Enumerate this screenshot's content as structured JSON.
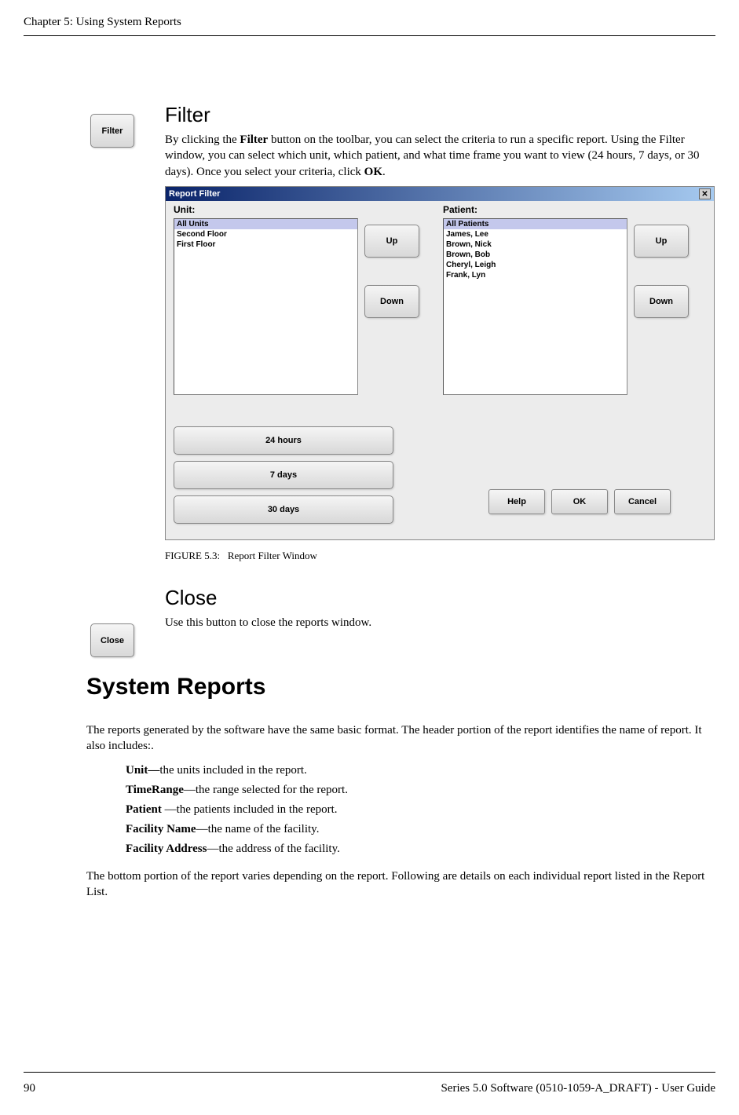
{
  "header": {
    "chapter_title": "Chapter 5: Using System Reports"
  },
  "filter_section": {
    "icon_label": "Filter",
    "heading": "Filter",
    "paragraph_part1": "By clicking the ",
    "paragraph_bold1": "Filter",
    "paragraph_part2": " button on the toolbar, you can select the criteria to run a specific report. Using the Filter window, you can select which unit, which patient, and what time frame you want to view (24 hours, 7 days, or 30 days). Once you select your criteria, click ",
    "paragraph_bold2": "OK",
    "paragraph_part3": "."
  },
  "dialog": {
    "title": "Report Filter",
    "close_x": "✕",
    "unit_label": "Unit:",
    "patient_label": "Patient:",
    "units": [
      "All Units",
      "Second Floor",
      "First Floor"
    ],
    "patients": [
      "All Patients",
      "James, Lee",
      "Brown, Nick",
      "Brown, Bob",
      "Cheryl, Leigh",
      "Frank, Lyn"
    ],
    "up_label": "Up",
    "down_label": "Down",
    "time_24": "24 hours",
    "time_7": "7 days",
    "time_30": "30 days",
    "help_label": "Help",
    "ok_label": "OK",
    "cancel_label": "Cancel"
  },
  "figure_caption": {
    "label": "FIGURE 5.3:",
    "text": "Report Filter Window"
  },
  "close_section": {
    "icon_label": "Close",
    "heading": "Close",
    "paragraph": "Use this button to close the reports window."
  },
  "system_reports": {
    "heading": "System Reports",
    "intro": "The reports generated by the software have the same basic format. The header portion of the report identifies the name of report. It also includes:.",
    "fields": [
      {
        "label": "Unit—",
        "desc": "the units included in the report."
      },
      {
        "label": "TimeRange",
        "desc": "—the range selected for the report."
      },
      {
        "label": "Patient ",
        "desc": "—the patients included in the report."
      },
      {
        "label": "Facility Name",
        "desc": "—the name of the facility."
      },
      {
        "label": "Facility Address",
        "desc": "—the address of the facility."
      }
    ],
    "outro": "The bottom portion of the report varies depending on the report. Following are details on each individual report listed in the Report List."
  },
  "footer": {
    "page_number": "90",
    "doc_title": "Series 5.0 Software (0510-1059-A_DRAFT) - User Guide"
  }
}
